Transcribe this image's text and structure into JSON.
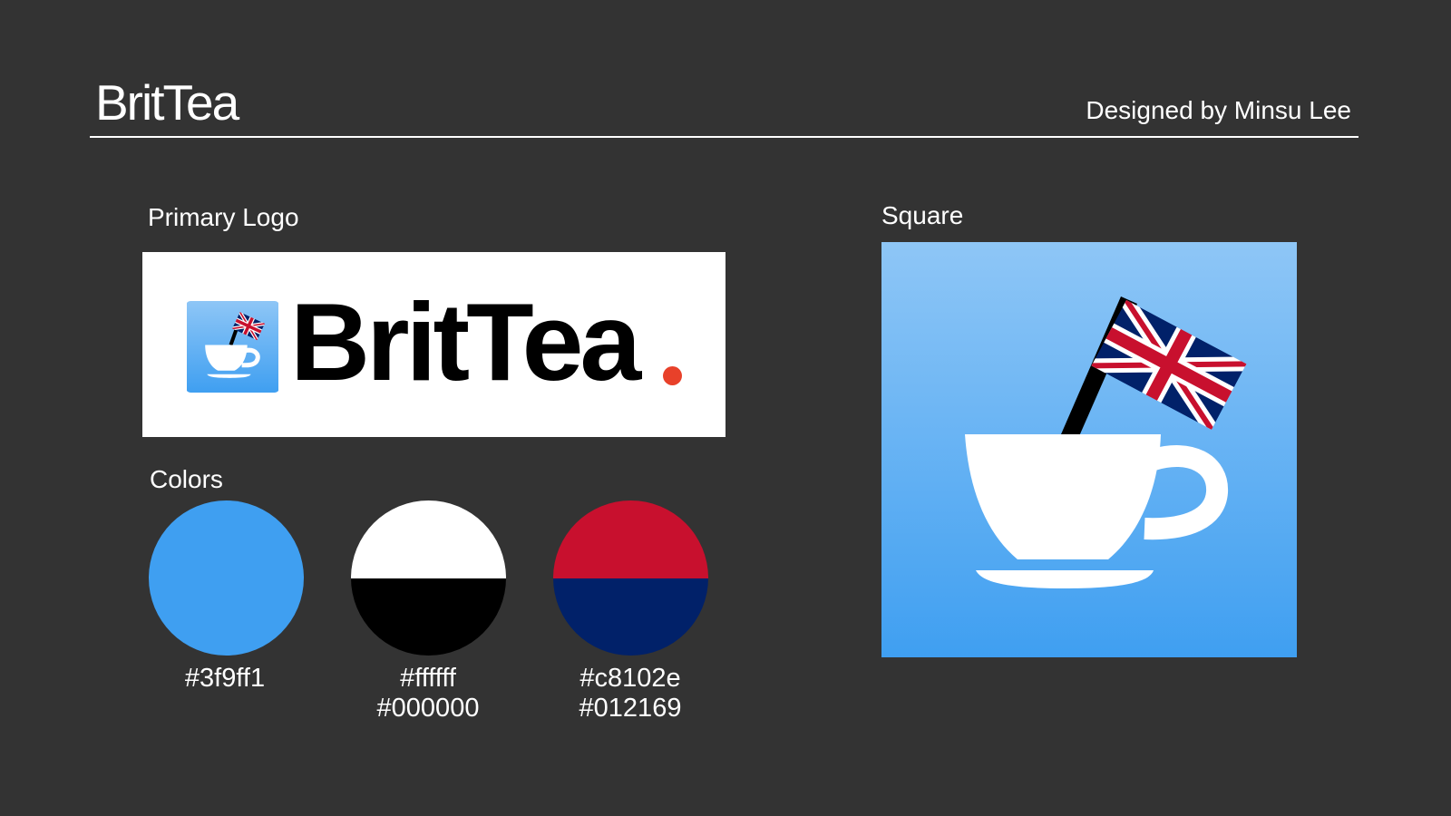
{
  "header": {
    "title": "BritTea",
    "designer": "Designed by Minsu Lee"
  },
  "primary_logo": {
    "label": "Primary Logo",
    "wordmark": "BritTea",
    "dot_color": "#e8412a"
  },
  "colors": {
    "label": "Colors",
    "swatches": [
      {
        "top": "#3f9ff1",
        "bottom": "#3f9ff1",
        "line1": "#3f9ff1",
        "line2": ""
      },
      {
        "top": "#ffffff",
        "bottom": "#000000",
        "line1": "#ffffff",
        "line2": "#000000"
      },
      {
        "top": "#c8102e",
        "bottom": "#012169",
        "line1": "#c8102e",
        "line2": "#012169"
      }
    ]
  },
  "square": {
    "label": "Square",
    "gradient_top": "#8ec6f6",
    "gradient_bottom": "#3f9ff1"
  }
}
